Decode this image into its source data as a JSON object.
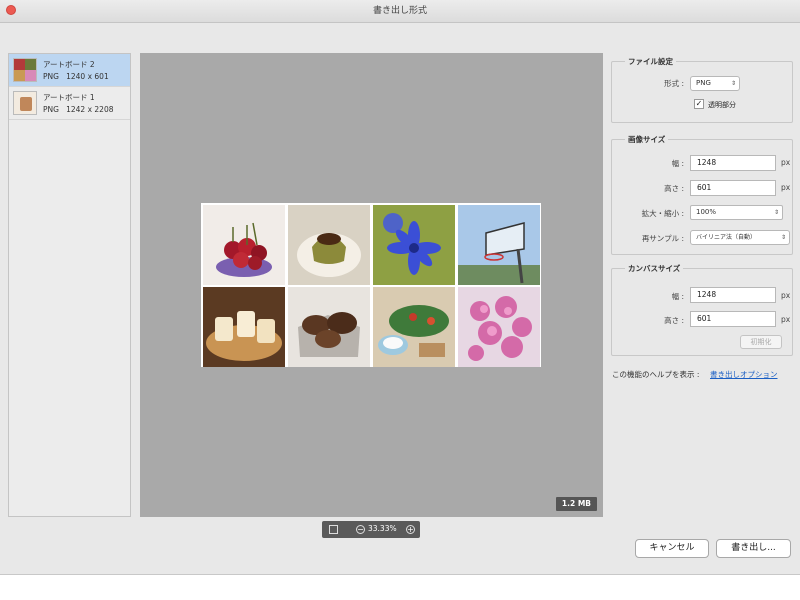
{
  "window": {
    "title": "書き出し形式"
  },
  "artboards": [
    {
      "name": "アートボード 2",
      "format": "PNG",
      "size": "1240 x 601",
      "selected": true
    },
    {
      "name": "アートボード 1",
      "format": "PNG",
      "size": "1242 x 2208",
      "selected": false
    }
  ],
  "preview": {
    "file_size": "1.2 MB",
    "zoom": "33.33%"
  },
  "file_settings": {
    "title": "ファイル設定",
    "format_label": "形式 :",
    "format_value": "PNG",
    "transparency_label": "透明部分",
    "transparency_checked": true
  },
  "image_size": {
    "title": "画像サイズ",
    "width_label": "幅 :",
    "width_value": "1248",
    "height_label": "高さ :",
    "height_value": "601",
    "scale_label": "拡大・縮小 :",
    "scale_value": "100%",
    "resample_label": "再サンプル :",
    "resample_value": "バイリニア法（自動）",
    "unit": "px"
  },
  "canvas_size": {
    "title": "カンバスサイズ",
    "width_label": "幅 :",
    "width_value": "1248",
    "height_label": "高さ :",
    "height_value": "601",
    "unit": "px",
    "reset_label": "初期化"
  },
  "help": {
    "text": "この機能のヘルプを表示 :",
    "link": "書き出しオプション"
  },
  "buttons": {
    "cancel": "キャンセル",
    "export": "書き出し..."
  }
}
